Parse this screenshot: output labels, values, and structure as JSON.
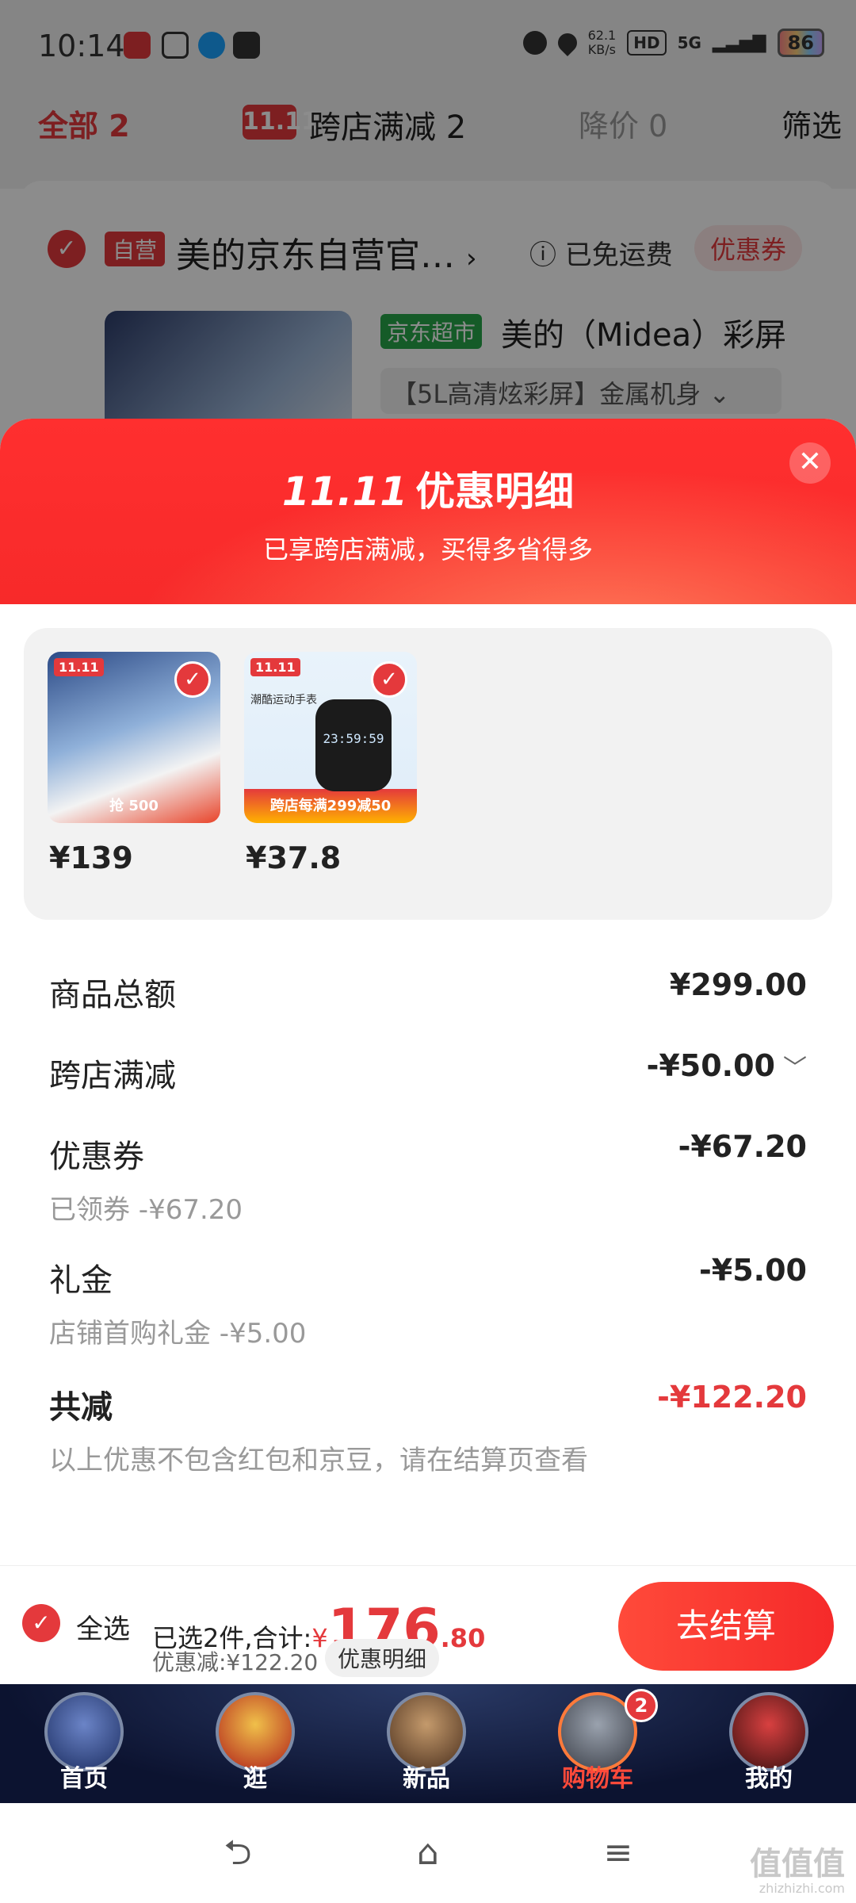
{
  "status_bar": {
    "time": "10:14",
    "net_speed": "62.1\nKB/s",
    "hd": "HD",
    "signal": "5G",
    "battery": "86"
  },
  "filter_bar": {
    "all_label": "全部 2",
    "cross_store_logo": "11.11",
    "cross_store_label": "跨店满减 2",
    "price_drop_label": "降价 0",
    "filter_label": "筛选"
  },
  "shop": {
    "self_tag": "自营",
    "name": "美的京东自营官…",
    "arrow": "›",
    "shipping": "ⓘ 已免运费",
    "coupon": "优惠券",
    "market_tag": "京东超市",
    "product_title": "美的（Midea）彩屏",
    "product_spec": "【5L高清炫彩屏】金属机身 ⌄"
  },
  "sheet": {
    "logo": "11.11",
    "title": "优惠明细",
    "subtitle": "已享跨店满减，买得多省得多",
    "close": "✕",
    "products": [
      {
        "price": "¥139",
        "badge": "11.11",
        "promo": "抢 500"
      },
      {
        "price": "¥37.8",
        "badge": "11.11",
        "promo": "跨店每满299减50",
        "watch_text": "潮酷运动手表",
        "watch_face": "23:59:59"
      }
    ],
    "rows": {
      "total_label": "商品总额",
      "total_value": "¥299.00",
      "cross_label": "跨店满减",
      "cross_value": "-¥50.00",
      "cross_chevron": "﹀",
      "coupon_label": "优惠券",
      "coupon_value": "-¥67.20",
      "coupon_sub": "已领券 -¥67.20",
      "gift_label": "礼金",
      "gift_value": "-¥5.00",
      "gift_sub": "店铺首购礼金 -¥5.00",
      "sum_label": "共减",
      "sum_value": "-¥122.20",
      "note": "以上优惠不包含红包和京豆，请在结算页查看"
    }
  },
  "checkout": {
    "select_all": "全选",
    "selected_text": "已选2件,合计:",
    "currency": "¥",
    "total_int": "176",
    "total_dec": ".80",
    "discount_text": "优惠减:¥122.20",
    "detail_btn": "优惠明细",
    "pay_btn": "去结算"
  },
  "tabbar": {
    "tabs": [
      {
        "label": "首页"
      },
      {
        "label": "逛"
      },
      {
        "label": "新品"
      },
      {
        "label": "购物车",
        "count": "2"
      },
      {
        "label": "我的"
      }
    ]
  },
  "sysnav": {
    "back": "⮌",
    "home": "⌂",
    "menu": "≡"
  },
  "watermark": {
    "text": "值值值",
    "domain": "zhizhizhi.com"
  },
  "colors": {
    "accent": "#e4393c",
    "header_red": "#f72a2a",
    "tabbar_bg": "#0c1330"
  }
}
